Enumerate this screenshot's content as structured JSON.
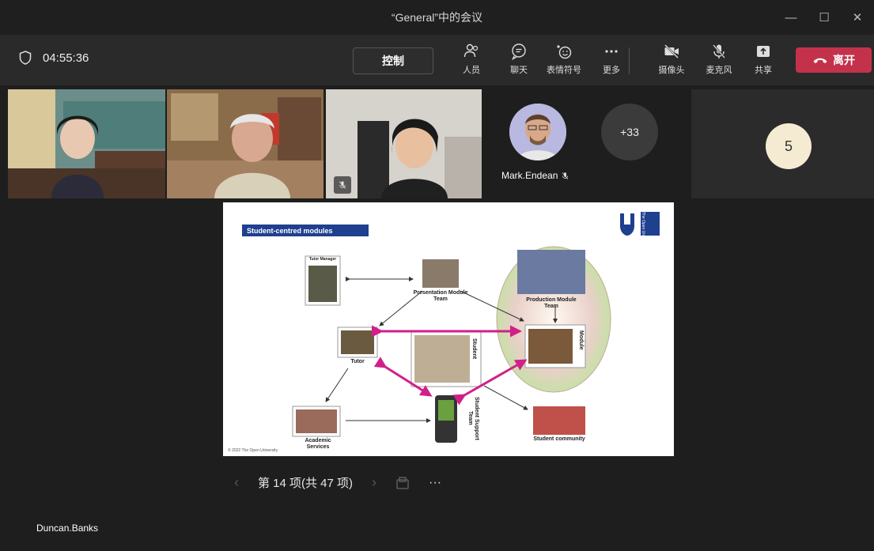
{
  "window": {
    "title": "“General”中的会议",
    "minimize": "—",
    "maximize": "☐",
    "close": "✕"
  },
  "toolbar": {
    "timer": "04:55:36",
    "control_label": "控制",
    "people_label": "人员",
    "chat_label": "聊天",
    "reactions_label": "表情符号",
    "more_label": "更多",
    "camera_label": "摄像头",
    "mic_label": "麦克风",
    "share_label": "共享",
    "leave_label": "离开"
  },
  "participants": {
    "avatar_name": "Mark.Endean",
    "more_count": "+33",
    "raised_count": "5"
  },
  "slide": {
    "title": "Student-centred modules",
    "nodes": {
      "tutor_manager": "Tutor Manager",
      "presentation_team": "Presentation Module Team",
      "production_team": "Production Module Team",
      "tutor": "Tutor",
      "student": "Student",
      "module": "Module",
      "academic_services": "Academic Services",
      "support_team": "Student Support Team",
      "community": "Student community"
    },
    "logo_text": "The Open University",
    "copyright": "© 2022 The Open University"
  },
  "pager": {
    "text": "第 14 项(共 47 项)",
    "prev": "‹",
    "next": "›",
    "more": "···"
  },
  "presenter": {
    "name": "Duncan.Banks"
  },
  "colors": {
    "leave": "#c4314b",
    "slide_title_bg": "#1f3f8f",
    "arrow_magenta": "#d0208a",
    "highlight": "#7a7ad6"
  }
}
